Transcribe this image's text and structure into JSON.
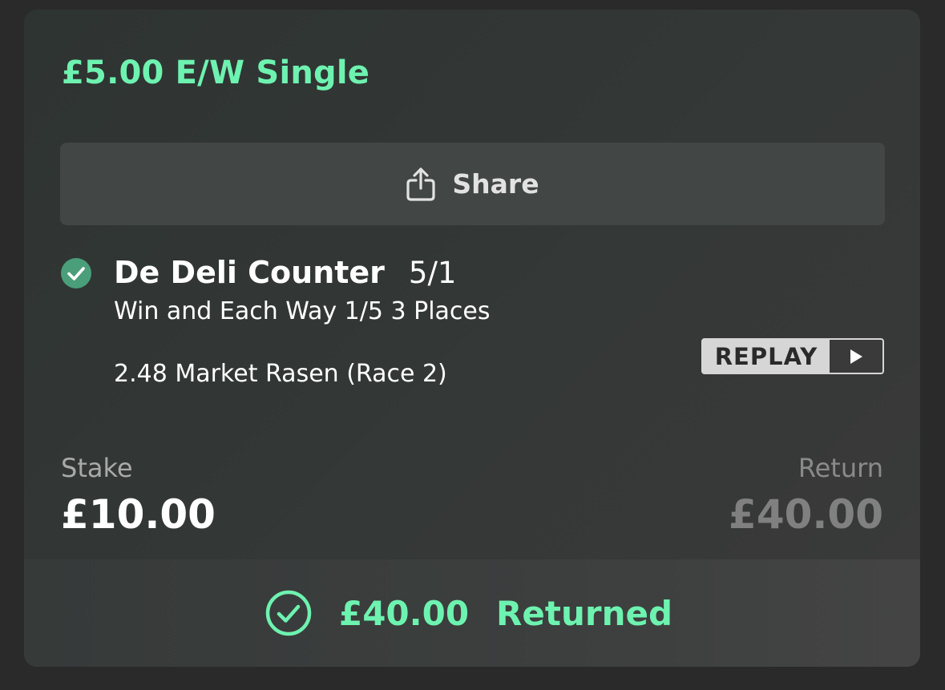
{
  "bet": {
    "title": "£5.00 E/W Single"
  },
  "share": {
    "label": "Share",
    "icon": "share-icon"
  },
  "selection": {
    "status_icon": "check-circle-icon",
    "name": "De Deli Counter",
    "odds": "5/1",
    "market": "Win and Each Way 1/5 3 Places",
    "event": "2.48 Market Rasen (Race 2)"
  },
  "replay": {
    "label": "REPLAY",
    "icon": "play-icon"
  },
  "stake": {
    "label": "Stake",
    "value": "£10.00"
  },
  "return": {
    "label": "Return",
    "value": "£40.00"
  },
  "footer": {
    "icon": "check-circle-outline-icon",
    "amount": "£40.00",
    "status": "Returned"
  },
  "colors": {
    "accent_green": "#6ef2b0",
    "settled_check": "#4a9e7a",
    "card_background": "#323634",
    "page_background": "#2a2a2a"
  }
}
